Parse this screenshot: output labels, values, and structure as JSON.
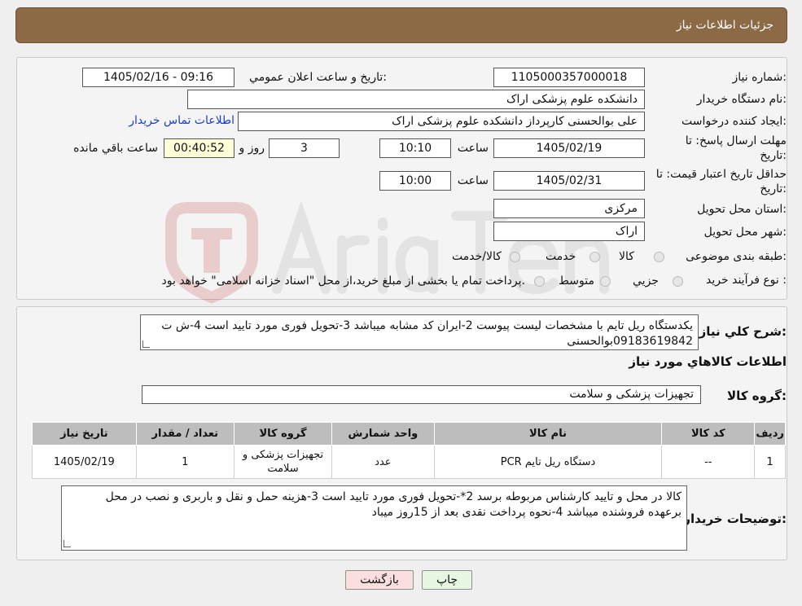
{
  "header": {
    "title": "جزئیات اطلاعات نیاز"
  },
  "form": {
    "need_number": {
      "label": "شماره نیاز:",
      "value": "1105000357000018"
    },
    "announce_datetime": {
      "label": "تاریخ و ساعت اعلان عمومي:",
      "value": "1405/02/16 - 09:16"
    },
    "buyer_org": {
      "label": "نام دستگاه خریدار:",
      "value": "دانشکده علوم پزشکی اراک"
    },
    "requester": {
      "label": "ایجاد کننده درخواست:",
      "value": "علی بوالحسنی کارپرداز دانشکده علوم پزشکی اراک",
      "contact_link": "اطلاعات تماس خریدار"
    },
    "reply_deadline": {
      "label_line1": "مهلت ارسال پاسخ: تا",
      "label_line2": "تاریخ:",
      "date": "1405/02/19",
      "time_label": "ساعت",
      "time": "10:10",
      "days": "3",
      "days_label": "روز و",
      "remaining": "00:40:52",
      "remaining_label": "ساعت باقي مانده"
    },
    "price_validity": {
      "label_line1": "حداقل تاریخ اعتبار قیمت: تا",
      "label_line2": "تاریخ:",
      "date": "1405/02/31",
      "time_label": "ساعت",
      "time": "10:00"
    },
    "province": {
      "label": "استان محل تحویل:",
      "value": "مرکزی"
    },
    "city": {
      "label": "شهر محل تحویل:",
      "value": "اراک"
    },
    "category": {
      "label": "طبقه بندی موضوعی:",
      "options": [
        "کالا",
        "خدمت",
        "کالا/خدمت"
      ]
    },
    "purchase_process": {
      "label": "نوع فرآیند خرید :",
      "options": [
        "جزیي",
        "متوسط"
      ],
      "note": "پرداخت تمام یا بخشی از مبلغ خرید،از محل \"اسناد خزانه اسلامی\" خواهد بود."
    }
  },
  "summary": {
    "label": "شرح کلي نیاز:",
    "text": "یکدستگاه ریل تایم با مشخصات لیست پیوست 2-ایران کد مشابه میباشد 3-تحویل فوری مورد تایید است 4-ش ت 09183619842بوالحسنی"
  },
  "goods_info_title": "اطلاعات کالاهاي مورد نیاز",
  "goods_group": {
    "label": "گروه کالا:",
    "value": "تجهیزات پزشکی و سلامت"
  },
  "goods_table": {
    "headers": [
      "ردیف",
      "کد کالا",
      "نام کالا",
      "واحد شمارش",
      "گروه کالا",
      "تعداد / مقدار",
      "تاریخ نیاز"
    ],
    "rows": [
      [
        "1",
        "--",
        "دستگاه ریل تایم PCR",
        "عدد",
        "تجهیزات پزشکی و سلامت",
        "1",
        "1405/02/19"
      ]
    ]
  },
  "buyer_notes": {
    "label": "توضیحات خریدار:",
    "text": "کالا در محل و تایید کارشناس مربوطه برسد 2*-تحویل فوری مورد تایید است 3-هزینه حمل و نقل و باربری و نصب در محل برعهده فروشنده میباشد 4-نحوه پرداخت نقدی بعد از 15روز میباد"
  },
  "buttons": {
    "print": "چاپ",
    "back": "بازگشت"
  }
}
